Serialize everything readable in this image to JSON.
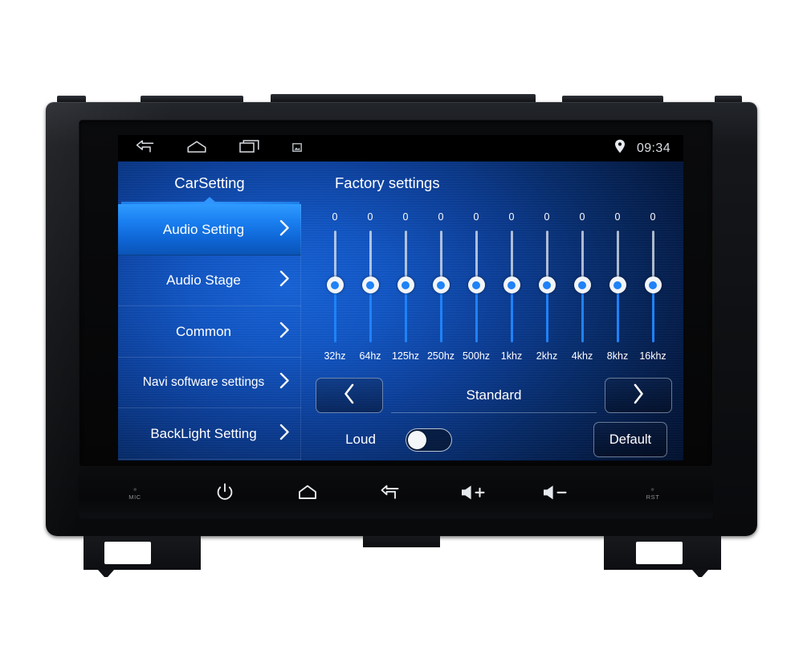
{
  "device": {
    "name": "car-head-unit"
  },
  "statusbar": {
    "icons": [
      "back-icon",
      "home-icon",
      "recents-icon",
      "screenshot-icon"
    ],
    "gps_icon": "location-pin-icon",
    "time": "09:34"
  },
  "tabs": {
    "carsetting_label": "CarSetting",
    "panel_title": "Factory settings"
  },
  "sidebar": {
    "items": [
      {
        "label": "Audio Setting",
        "selected": true
      },
      {
        "label": "Audio Stage",
        "selected": false
      },
      {
        "label": "Common",
        "selected": false
      },
      {
        "label": "Navi software settings",
        "selected": false
      },
      {
        "label": "BackLight Setting",
        "selected": false
      }
    ]
  },
  "equalizer": {
    "bands": [
      {
        "label": "32hz",
        "value": "0"
      },
      {
        "label": "64hz",
        "value": "0"
      },
      {
        "label": "125hz",
        "value": "0"
      },
      {
        "label": "250hz",
        "value": "0"
      },
      {
        "label": "500hz",
        "value": "0"
      },
      {
        "label": "1khz",
        "value": "0"
      },
      {
        "label": "2khz",
        "value": "0"
      },
      {
        "label": "4khz",
        "value": "0"
      },
      {
        "label": "8khz",
        "value": "0"
      },
      {
        "label": "16khz",
        "value": "0"
      }
    ],
    "preset": "Standard",
    "prev_icon": "chevron-left-icon",
    "next_icon": "chevron-right-icon",
    "loud_label": "Loud",
    "loud_enabled": false,
    "default_label": "Default"
  },
  "hardware_buttons": [
    {
      "name": "mic",
      "sub": "MIC",
      "icon": "microphone-hole-icon"
    },
    {
      "name": "power",
      "sub": "",
      "icon": "power-icon"
    },
    {
      "name": "home",
      "sub": "",
      "icon": "home-icon"
    },
    {
      "name": "back",
      "sub": "",
      "icon": "back-icon"
    },
    {
      "name": "volume-up",
      "sub": "",
      "icon": "volume-up-icon"
    },
    {
      "name": "volume-down",
      "sub": "",
      "icon": "volume-down-icon"
    },
    {
      "name": "reset",
      "sub": "RST",
      "icon": "reset-hole-icon"
    }
  ],
  "colors": {
    "accent_blue": "#1f82f7",
    "selected_blue": "#1a7ff0",
    "screen_black": "#000307",
    "chassis_black": "#0e1013"
  }
}
